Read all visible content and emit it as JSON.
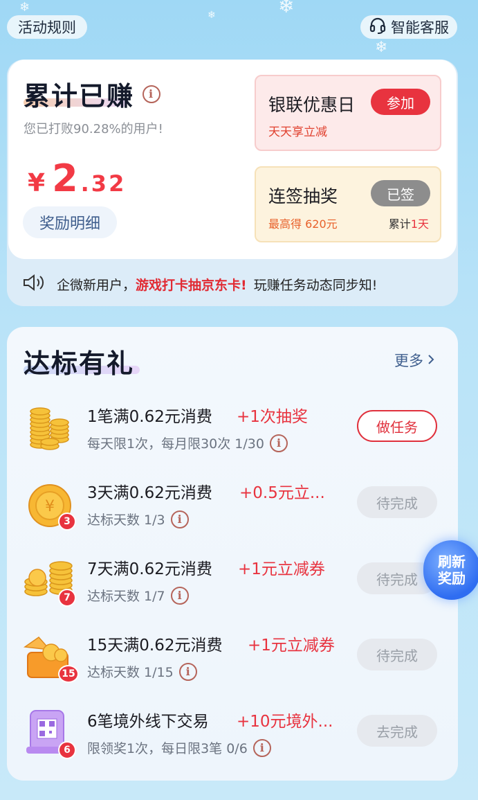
{
  "header": {
    "rules": "活动规则",
    "service": "智能客服"
  },
  "earnings": {
    "title": "累计已赚",
    "beat_text": "您已打败90.28%的用户!",
    "currency": "¥",
    "amount_int": "2",
    "amount_dec": ".32",
    "detail_button": "奖励明细"
  },
  "unionpay": {
    "title": "银联优惠日",
    "button": "参加",
    "subtitle": "天天享立减"
  },
  "signin": {
    "title": "连签抽奖",
    "button": "已签",
    "max_prefix": "最高得 620元",
    "streak_prefix": "累计",
    "streak_days": "1天"
  },
  "marquee": {
    "pre": "企微新用户，",
    "highlight": "游戏打卡抽京东卡!",
    "post": "玩赚任务动态同步知!"
  },
  "tasks_section": {
    "title": "达标有礼",
    "more": "更多"
  },
  "tasks": [
    {
      "name": "1笔满0.62元消费",
      "reward": "+1次抽奖",
      "sub": "每天限1次，每月限30次 1/30",
      "button": "做任务",
      "badge": ""
    },
    {
      "name": "3天满0.62元消费",
      "reward": "+0.5元立...",
      "sub": "达标天数 1/3",
      "button": "待完成",
      "badge": "3"
    },
    {
      "name": "7天满0.62元消费",
      "reward": "+1元立减券",
      "sub": "达标天数 1/7",
      "button": "待完成",
      "badge": "7"
    },
    {
      "name": "15天满0.62元消费",
      "reward": "+1元立减券",
      "sub": "达标天数 1/15",
      "button": "待完成",
      "badge": "15"
    },
    {
      "name": "6笔境外线下交易",
      "reward": "+10元境外...",
      "sub": "限领奖1次，每日限3笔 0/6",
      "button": "去完成",
      "badge": "6"
    }
  ],
  "refresh": {
    "line1": "刷新",
    "line2": "奖励"
  },
  "colors": {
    "accent_red": "#e8333f",
    "link_blue": "#3f5f8e"
  },
  "icons": [
    "info-icon",
    "headset-icon",
    "speaker-icon",
    "chevron-right-icon",
    "coin-stack-icon",
    "coin-icon",
    "gift-box-icon",
    "qr-card-icon"
  ]
}
